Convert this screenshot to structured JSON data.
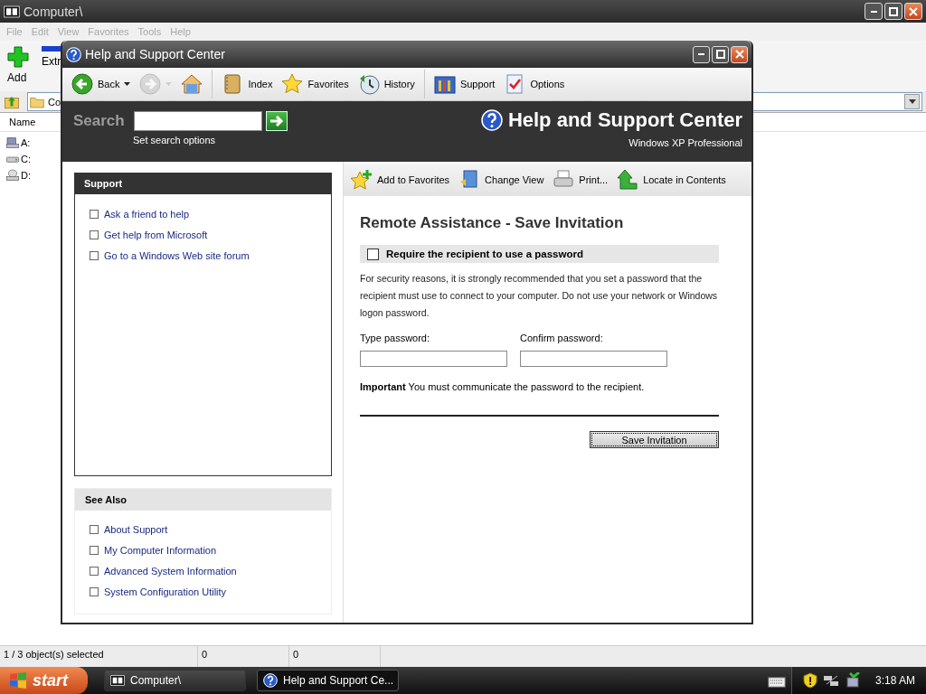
{
  "background_window": {
    "title": "Computer\\",
    "menu": [
      "File",
      "Edit",
      "View",
      "Favorites",
      "Tools",
      "Help"
    ],
    "toolbar": [
      {
        "kind": "add",
        "label": "Add"
      },
      {
        "kind": "extract",
        "label": "Extr"
      }
    ],
    "address": "Co",
    "columns": [
      "Name"
    ],
    "items": [
      {
        "kind": "floppy",
        "name": "A:"
      },
      {
        "kind": "drive",
        "name": "C:"
      },
      {
        "kind": "cd",
        "name": "D:"
      }
    ],
    "status_bar": [
      "1 / 3 object(s) selected",
      "0",
      "0"
    ]
  },
  "help_window": {
    "title": "Help and Support Center",
    "toolbar": [
      {
        "kind": "back",
        "label": "Back",
        "disabled": false,
        "dropdown": true
      },
      {
        "kind": "forward",
        "disabled": true,
        "dropdown": true
      },
      {
        "kind": "home",
        "disabled": false,
        "dropdown": false
      },
      {
        "kind": "separator"
      },
      {
        "kind": "index",
        "label": "Index",
        "disabled": false,
        "dropdown": false
      },
      {
        "kind": "favorites",
        "label": "Favorites",
        "disabled": false,
        "dropdown": false
      },
      {
        "kind": "history",
        "label": "History",
        "disabled": false,
        "dropdown": false
      },
      {
        "kind": "separator"
      },
      {
        "kind": "support",
        "label": "Support",
        "disabled": false,
        "dropdown": false
      },
      {
        "kind": "options",
        "label": "Options",
        "disabled": false,
        "dropdown": false
      }
    ],
    "search": {
      "label": "Search",
      "options_link": "Set search options"
    },
    "banner": {
      "title": "Help and Support Center",
      "edition": "Windows XP Professional"
    },
    "support_box": {
      "title": "Support",
      "links": [
        "Ask a friend to help",
        "Get help from Microsoft",
        "Go to a Windows Web site forum"
      ]
    },
    "see_also": {
      "title": "See Also",
      "links": [
        "About Support",
        "My Computer Information",
        "Advanced System Information",
        "System Configuration Utility"
      ]
    },
    "page_toolbar": [
      {
        "kind": "add-favorite",
        "label": "Add to Favorites"
      },
      {
        "kind": "change-view",
        "label": "Change View"
      },
      {
        "kind": "print",
        "label": "Print..."
      },
      {
        "kind": "locate",
        "label": "Locate in Contents"
      }
    ],
    "page": {
      "heading": "Remote Assistance - Save Invitation",
      "password_option": {
        "label": "Require the recipient to use a password",
        "checked": false
      },
      "explanation": "For security reasons, it is strongly recommended that you set a password that the recipient must use to connect to your computer. Do not use your network or Windows logon password.",
      "fields": [
        {
          "label": "Type password:"
        },
        {
          "label": "Confirm password:"
        }
      ],
      "note": "**Important** You must communicate the password to the recipient.",
      "button": "Save Invitation"
    }
  },
  "taskbar": {
    "start": "start",
    "tasks": [
      {
        "kind": "archive",
        "label": "Computer\\",
        "selected": false
      },
      {
        "kind": "help",
        "label": "Help and Support Ce...",
        "selected": true
      }
    ],
    "clock": "3:18 AM"
  }
}
